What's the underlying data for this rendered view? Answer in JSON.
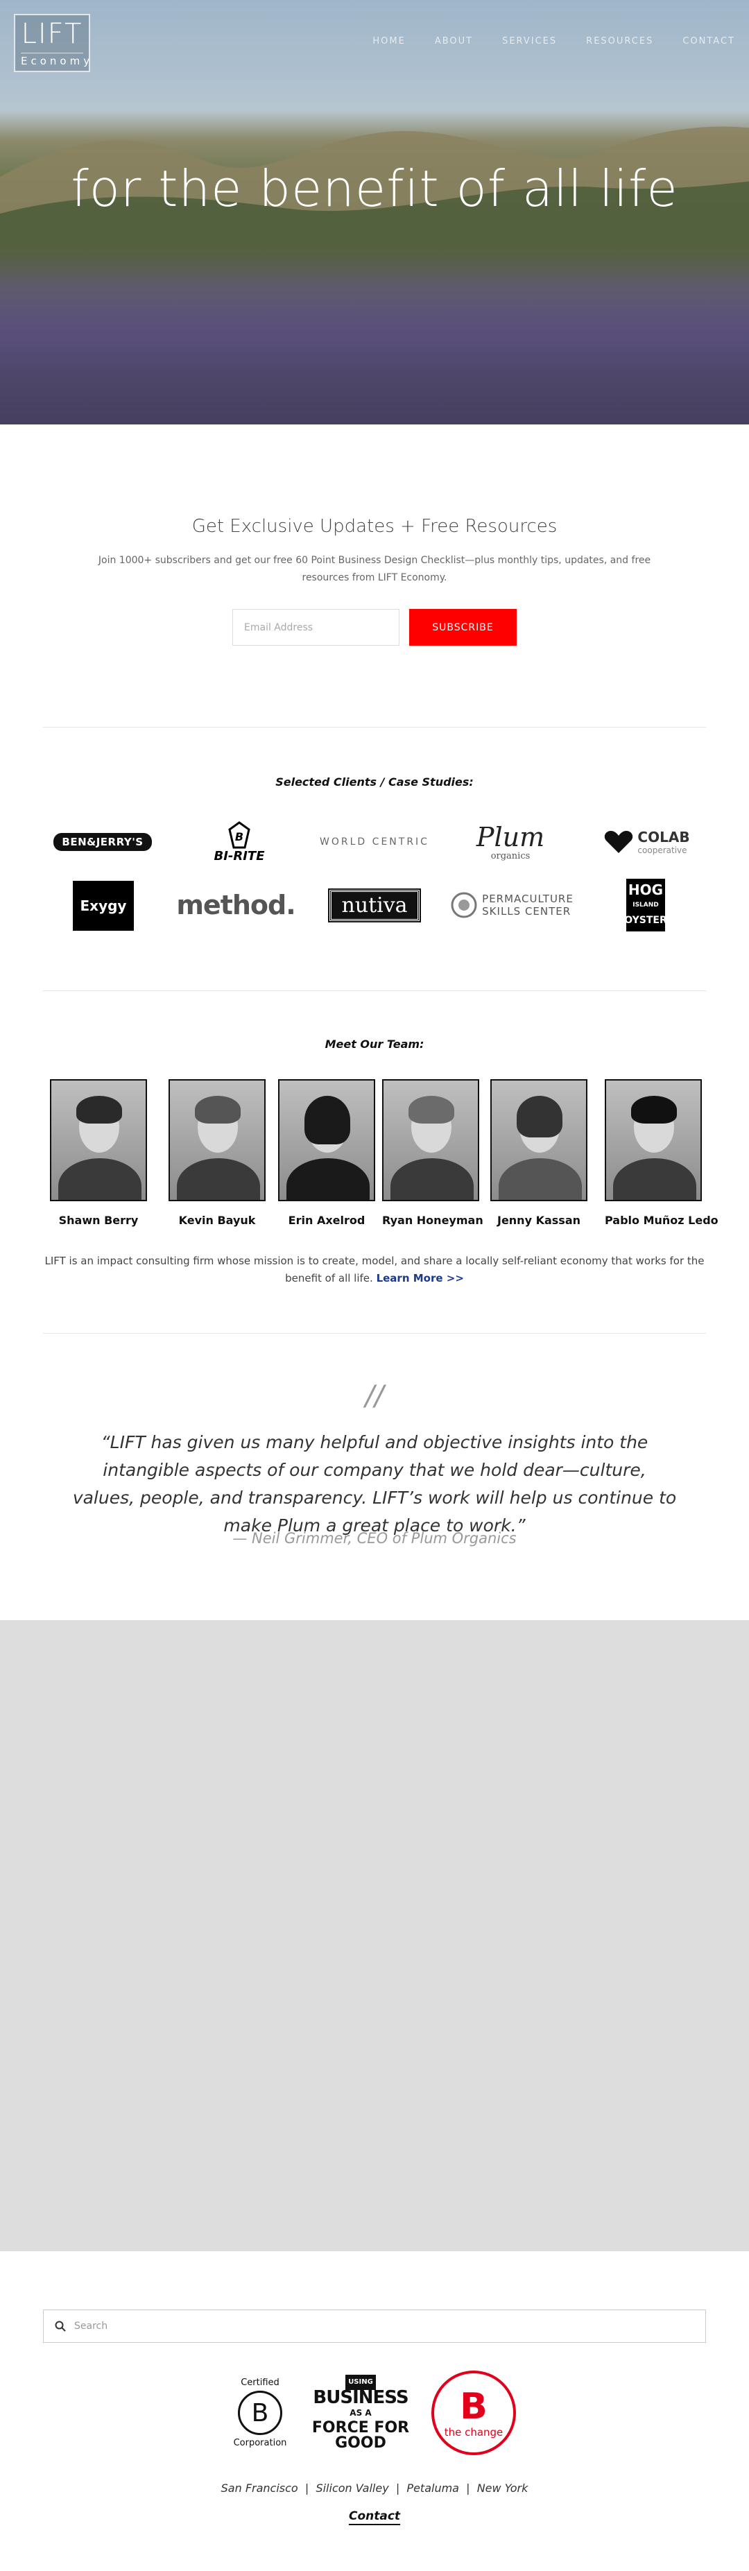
{
  "header": {
    "logo_main": "LIFT",
    "logo_sub": "Economy",
    "nav": [
      "HOME",
      "ABOUT",
      "SERVICES",
      "RESOURCES",
      "CONTACT"
    ]
  },
  "hero": {
    "title": "for the benefit of all life"
  },
  "newsletter": {
    "title": "Get Exclusive Updates + Free Resources",
    "description": "Join 1000+ subscribers and get our free 60 Point Business Design Checklist—plus monthly tips, updates, and free resources from LIFT Economy.",
    "email_placeholder": "Email Address",
    "subscribe_label": "SUBSCRIBE"
  },
  "clients": {
    "heading": "Selected Clients / Case Studies:",
    "logos": {
      "benjerry": "BEN&JERRY'S",
      "birite": "BI-RITE",
      "worldcentric": "WORLD CENTRIC",
      "plum": "Plum",
      "plum_sub": "organics",
      "colab": "COLAB",
      "colab_sub": "cooperative",
      "exygy": "Exygy",
      "method": "method.",
      "nutiva": "nutiva",
      "perma1": "PERMACULTURE",
      "perma2": "SKILLS CENTER",
      "hog1": "HOG",
      "hog2": "ISLAND",
      "hog3": "OYSTER"
    }
  },
  "team": {
    "heading": "Meet Our Team:",
    "members": [
      "Shawn Berry",
      "Kevin Bayuk",
      "Erin Axelrod",
      "Ryan Honeyman",
      "Jenny Kassan",
      "Pablo Muñoz Ledo"
    ],
    "mission": "LIFT is an impact consulting firm whose mission is to create, model, and share a locally self-reliant economy that works for the benefit of all life.",
    "learn_more": "Learn More >>"
  },
  "testimonial": {
    "mark": "//",
    "quote": "“LIFT has given us many helpful and objective insights into the intangible aspects of our company that we hold dear—culture, values, people, and transparency. LIFT’s work will help us continue to make Plum a great place to work.”",
    "attribution": "— Neil Grimmer, CEO of Plum Organics"
  },
  "footer": {
    "search_placeholder": "Search",
    "bcorp": {
      "line1": "Certified",
      "letter": "B",
      "line2": "Corporation"
    },
    "force": {
      "l1": "USING",
      "l2": "BUSINESS",
      "l3": "AS A",
      "l4": "FORCE FOR GOOD"
    },
    "bchange": {
      "letter": "B",
      "text": "the change"
    },
    "cities": "San Francisco  |  Silicon Valley  |  Petaluma  |  New York",
    "contact": "Contact"
  },
  "colors": {
    "subscribe": "#ff0000",
    "link": "#1a3a8a",
    "grey_block": "#dddddd"
  }
}
